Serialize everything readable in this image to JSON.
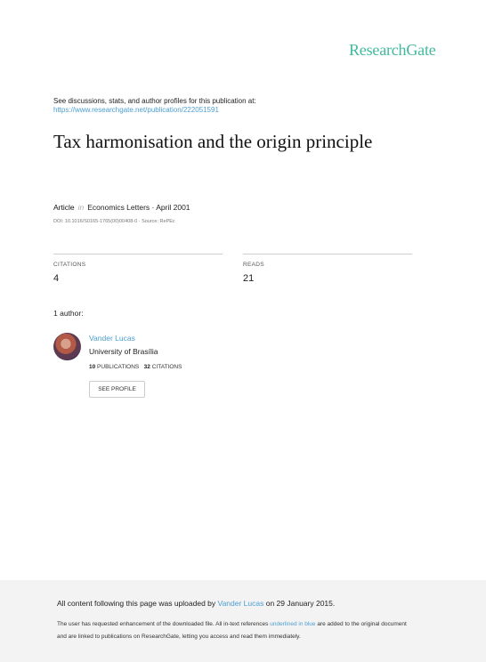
{
  "header": {
    "logo_text": "ResearchGate",
    "discussion_text": "See discussions, stats, and author profiles for this publication at:",
    "publication_url": "https://www.researchgate.net/publication/222051591"
  },
  "publication": {
    "title": "Tax harmonisation and the origin principle",
    "type": "Article",
    "in_word": "in",
    "journal": "Economics Letters · April 2001",
    "doi_line": "DOI: 10.1016/S0165-1765(00)00408-0 · Source: RePEc"
  },
  "stats": {
    "citations_label": "CITATIONS",
    "citations_value": "4",
    "reads_label": "READS",
    "reads_value": "21"
  },
  "authors": {
    "heading": "1 author:",
    "items": [
      {
        "name": "Vander Lucas",
        "affiliation": "University of Brasília",
        "publications_count": "10",
        "publications_label": "PUBLICATIONS",
        "citations_count": "32",
        "citations_label": "CITATIONS",
        "profile_button": "SEE PROFILE"
      }
    ]
  },
  "footer": {
    "upload_prefix": "All content following this page was uploaded by",
    "upload_name": "Vander Lucas",
    "upload_suffix": "on 29 January 2015.",
    "note_prefix": "The user has requested enhancement of the downloaded file. All in-text references",
    "note_link": "underlined in blue",
    "note_suffix": "are added to the original document",
    "note_line2": "and are linked to publications on ResearchGate, letting you access and read them immediately."
  },
  "colors": {
    "brand": "#40ba9b",
    "link": "#4c9ed1",
    "footer_bg": "#f3f3f3"
  }
}
